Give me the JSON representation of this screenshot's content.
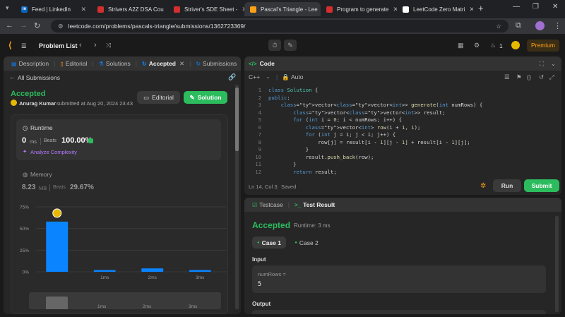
{
  "browser": {
    "tabs": [
      {
        "title": "Feed | LinkedIn",
        "icon": "in",
        "color": "#0a66c2"
      },
      {
        "title": "Strivers A2Z DSA Cou",
        "icon": "tuf",
        "color": "#d32f2f"
      },
      {
        "title": "Striver's SDE Sheet -",
        "icon": "tuf",
        "color": "#d32f2f"
      },
      {
        "title": "Pascal's Triangle - Lee",
        "icon": "lc",
        "color": "#ffa116"
      },
      {
        "title": "Program to generate",
        "icon": "tuf",
        "color": "#d32f2f"
      },
      {
        "title": "LeetCode Zero Matri",
        "icon": "lc",
        "color": "#ffffff"
      }
    ],
    "url": "leetcode.com/problems/pascals-triangle/submissions/1362723369/"
  },
  "nav": {
    "problem_list": "Problem List",
    "fire_count": "1",
    "premium": "Premium"
  },
  "left": {
    "tabs": [
      "Description",
      "Editorial",
      "Solutions",
      "Accepted",
      "Submissions"
    ],
    "back": "All Submissions",
    "status": "Accepted",
    "user": "Anurag Kumar",
    "submitted": "submitted at Aug 20, 2024 23:43",
    "editorial_btn": "Editorial",
    "solution_btn": "Solution",
    "runtime": {
      "label": "Runtime",
      "value": "0",
      "unit": "ms",
      "beats_label": "Beats",
      "beats": "100.00%",
      "analyze": "Analyze Complexity"
    },
    "memory": {
      "label": "Memory",
      "value": "8.23",
      "unit": "MB",
      "beats_label": "Beats",
      "beats": "29.67%"
    }
  },
  "chart_data": {
    "type": "bar",
    "categories": [
      "0ms",
      "1ms",
      "2ms",
      "3ms"
    ],
    "values": [
      58,
      2,
      4,
      2
    ],
    "yticks": [
      "75%",
      "50%",
      "25%",
      "0%"
    ],
    "ylim": [
      0,
      75
    ],
    "xlabels": [
      "",
      "1ms",
      "2ms",
      "3ms"
    ],
    "highlight": 0,
    "color": "#0a84ff"
  },
  "minimap": {
    "labels": [
      "1ms",
      "2ms",
      "3ms"
    ]
  },
  "code": {
    "title": "Code",
    "lang": "C++",
    "mode": "Auto",
    "lines": [
      "class Solution {",
      "public:",
      "    vector<vector<int>> generate(int numRows) {",
      "        vector<vector<int>> result;",
      "        for (int i = 0; i < numRows; i++) {",
      "            vector<int> row(i + 1, 1);",
      "            for (int j = 1; j < i; j++) {",
      "                row[j] = result[i - 1][j - 1] + result[i - 1][j];",
      "            }",
      "            result.push_back(row);",
      "        }",
      "        return result;"
    ],
    "status_pos": "Ln 14, Col 3",
    "status_saved": "Saved",
    "run": "Run",
    "submit": "Submit"
  },
  "test": {
    "tab_testcase": "Testcase",
    "tab_result": "Test Result",
    "status": "Accepted",
    "runtime": "Runtime: 3 ms",
    "cases": [
      "Case 1",
      "Case 2"
    ],
    "input_label": "Input",
    "var_name": "numRows =",
    "var_value": "5",
    "output_label": "Output"
  },
  "colors": {
    "accepted": "#2cbb5d",
    "premium": "#ffa116",
    "bar": "#0a84ff"
  }
}
